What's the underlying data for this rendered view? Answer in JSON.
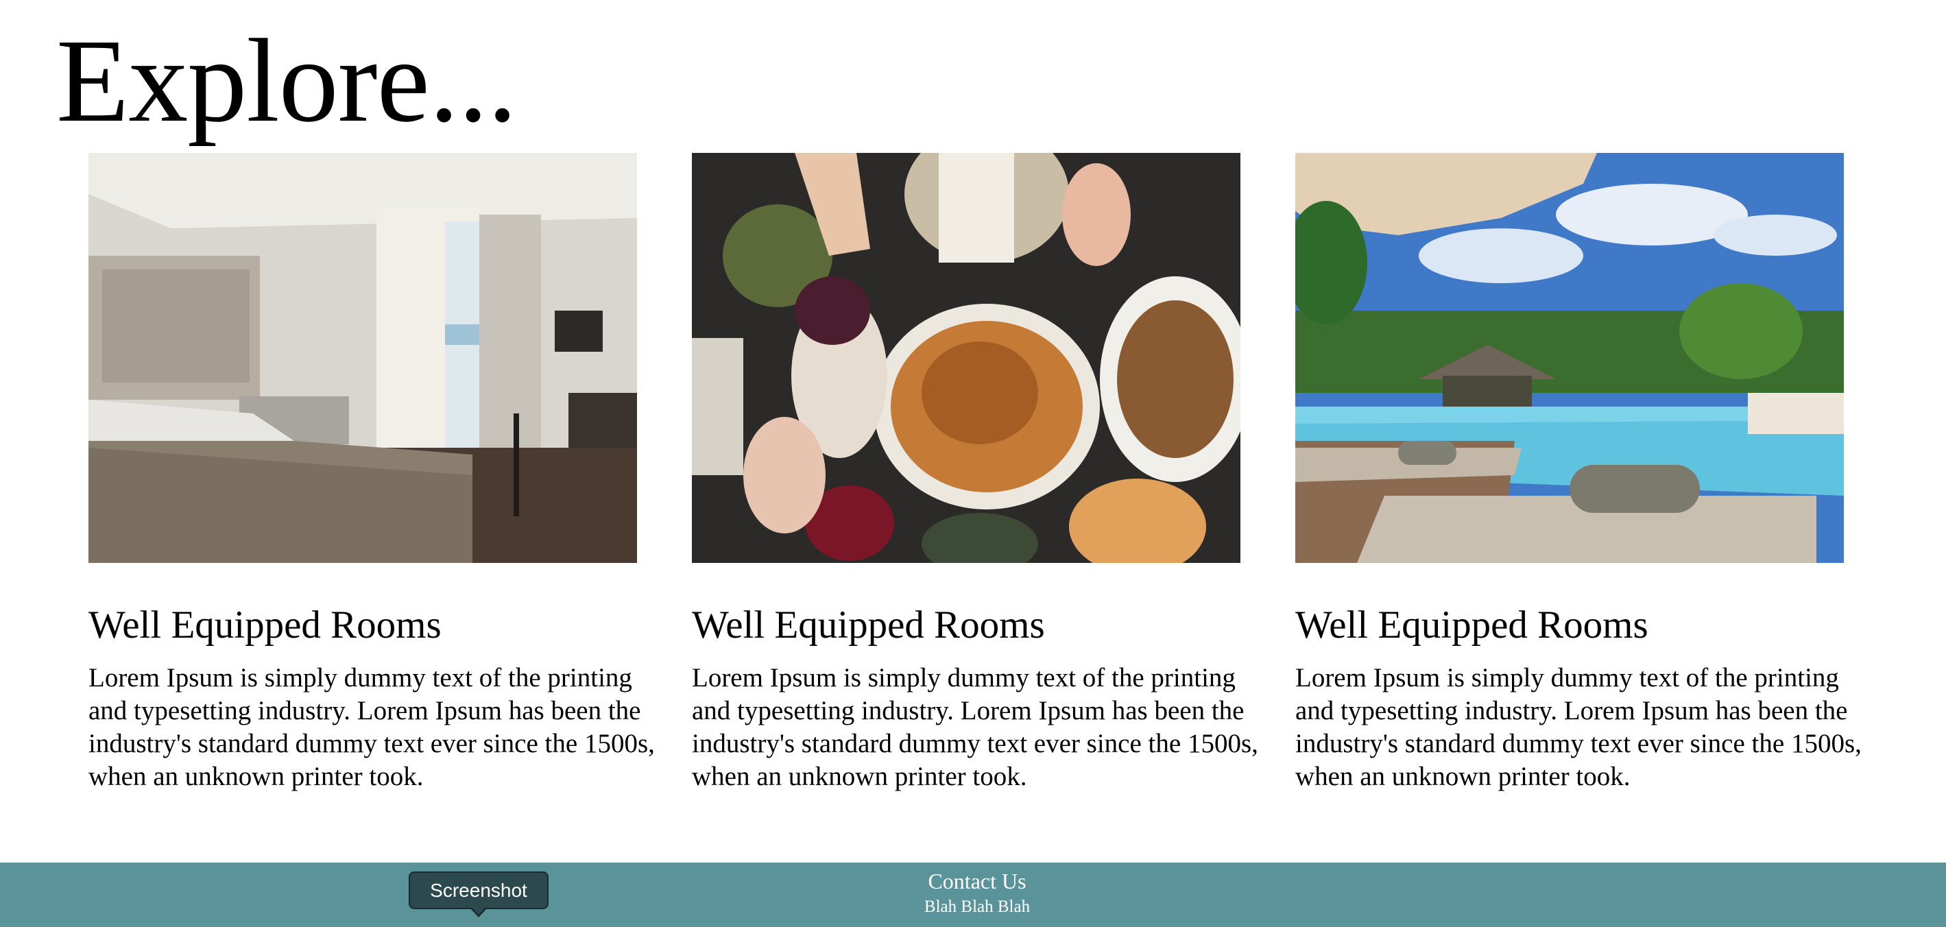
{
  "page": {
    "title": "Explore..."
  },
  "cards": [
    {
      "heading": "Well Equipped Rooms",
      "body": "Lorem Ipsum is simply dummy text of the printing and typesetting industry. Lorem Ipsum has been the industry's standard dummy text ever since the 1500s, when an unknown printer took.",
      "image": "hotel-bedroom-photo"
    },
    {
      "heading": "Well Equipped Rooms",
      "body": "Lorem Ipsum is simply dummy text of the printing and typesetting industry. Lorem Ipsum has been the industry's standard dummy text ever since the 1500s, when an unknown printer took.",
      "image": "dinner-table-photo"
    },
    {
      "heading": "Well Equipped Rooms",
      "body": "Lorem Ipsum is simply dummy text of the printing and typesetting industry. Lorem Ipsum has been the industry's standard dummy text ever since the 1500s, when an unknown printer took.",
      "image": "resort-pool-photo"
    }
  ],
  "footer": {
    "contact": "Contact Us",
    "subtext": "Blah Blah Blah",
    "background": "#5a9399"
  },
  "tooltip": {
    "label": "Screenshot"
  }
}
